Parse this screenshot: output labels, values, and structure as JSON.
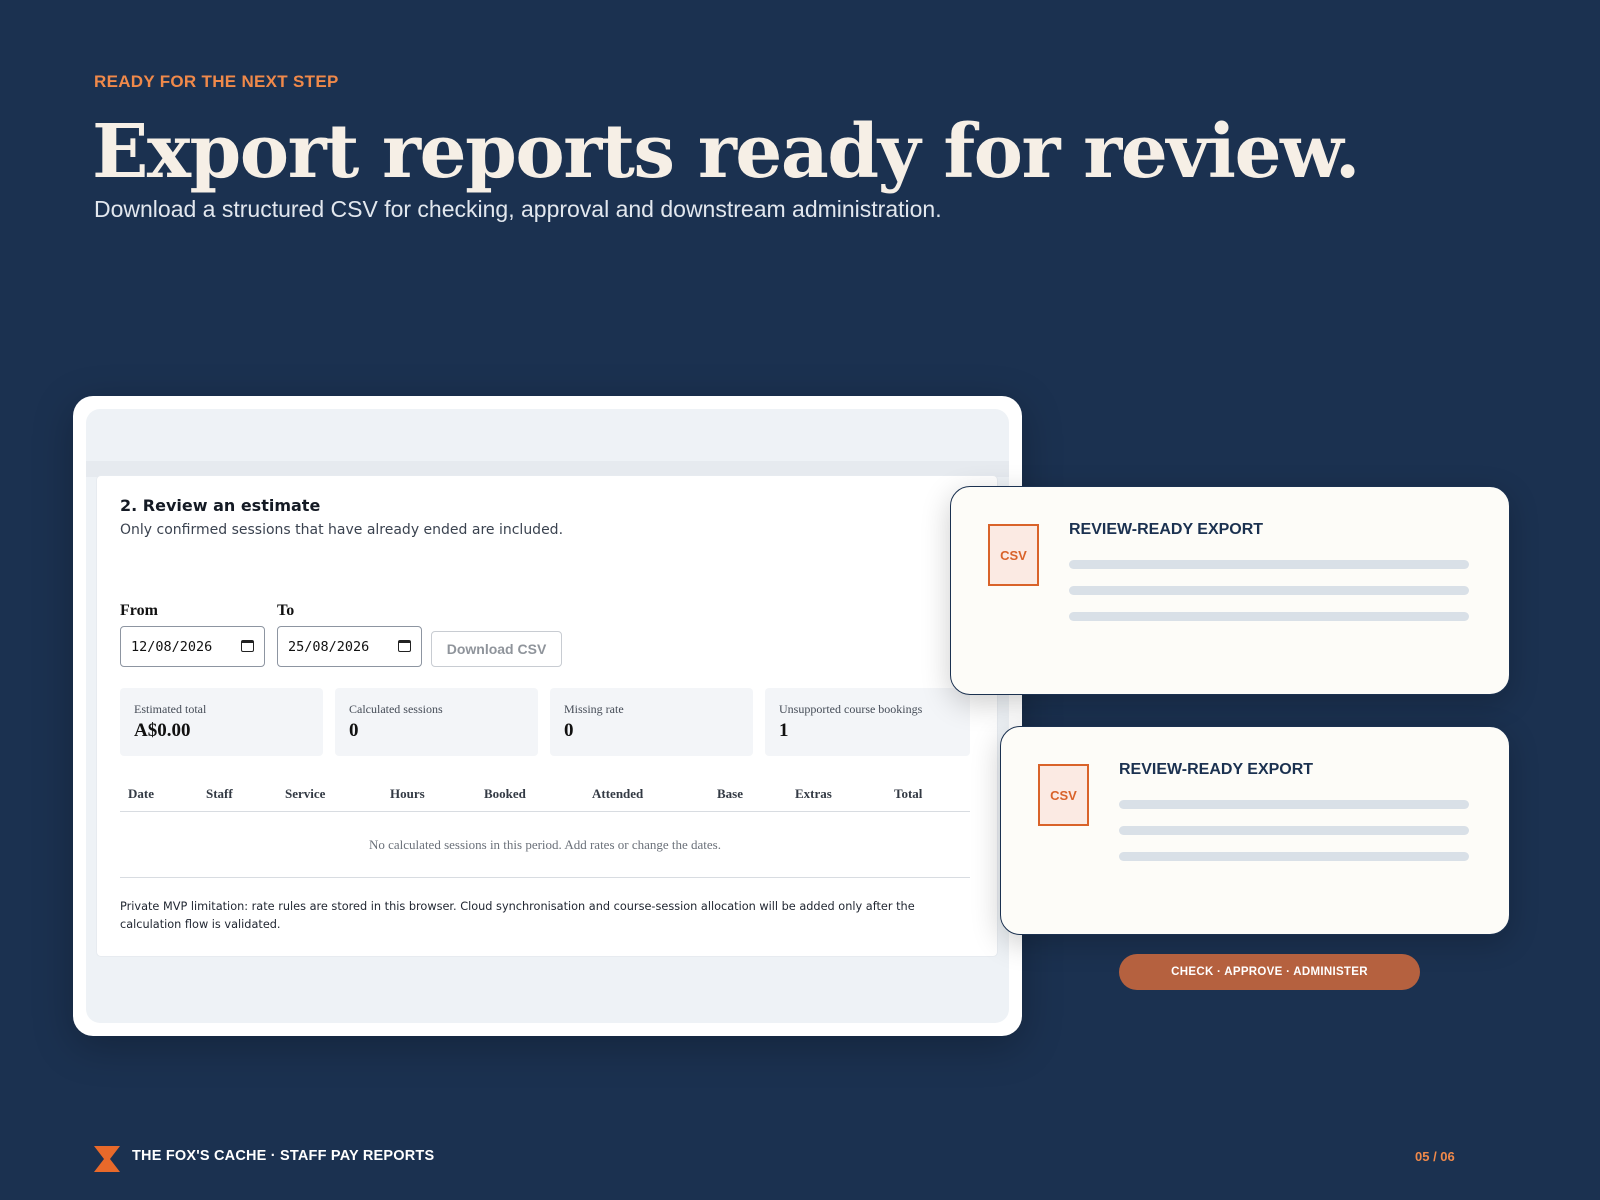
{
  "eyebrow": "READY FOR THE NEXT STEP",
  "headline": "Export reports ready for review.",
  "subheadline": "Download a structured CSV for checking, approval and downstream administration.",
  "app": {
    "card_title": "2. Review an estimate",
    "card_subtitle": "Only confirmed sessions that have already ended are included.",
    "from_label": "From",
    "to_label": "To",
    "from_value": "12/08/2026",
    "to_value": "25/08/2026",
    "download_label": "Download CSV",
    "stats": [
      {
        "label": "Estimated total",
        "value": "A$0.00"
      },
      {
        "label": "Calculated sessions",
        "value": "0"
      },
      {
        "label": "Missing rate",
        "value": "0"
      },
      {
        "label": "Unsupported course bookings",
        "value": "1"
      }
    ],
    "columns": [
      "Date",
      "Staff",
      "Service",
      "Hours",
      "Booked",
      "Attended",
      "Base",
      "Extras",
      "Total"
    ],
    "empty_message": "No calculated sessions in this period. Add rates or change the dates.",
    "note": "Private MVP limitation: rate rules are stored in this browser. Cloud synchronisation and course-session allocation will be added only after the calculation flow is validated."
  },
  "exports": [
    {
      "icon_label": "CSV",
      "title": "REVIEW-READY EXPORT"
    },
    {
      "icon_label": "CSV",
      "title": "REVIEW-READY EXPORT"
    }
  ],
  "pill_label": "CHECK · APPROVE · ADMINISTER",
  "footer": {
    "brand": "THE FOX'S CACHE · STAFF PAY REPORTS",
    "page": "05 / 06"
  },
  "colors": {
    "background": "#1b3150",
    "accent": "#f0894a",
    "csv_orange": "#d9632a",
    "pill": "#b5613f"
  },
  "icons": {
    "footer_logo": "hourglass-logo-icon",
    "calendar": "calendar-icon",
    "file": "csv-file-icon"
  }
}
